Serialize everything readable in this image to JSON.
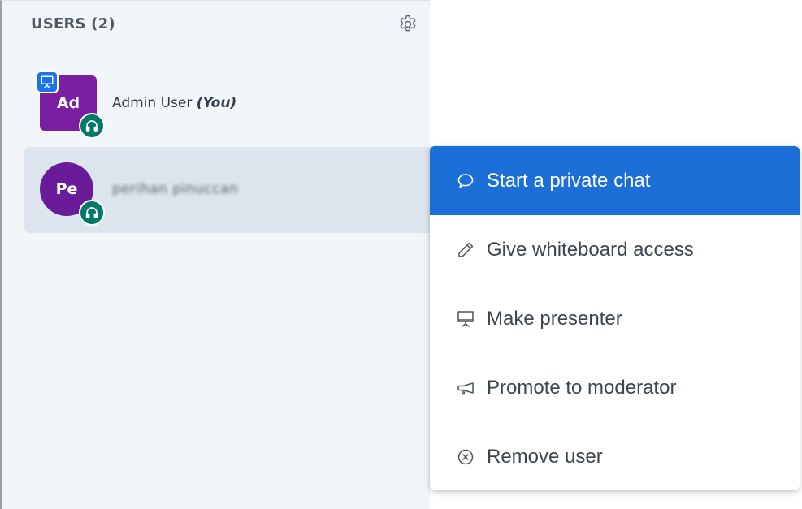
{
  "users_panel": {
    "title": "USERS (2)",
    "settings_icon": "gear-icon",
    "users": [
      {
        "initials": "Ad",
        "name": "Admin User",
        "you_label": "(You)",
        "avatar_color": "#7b1fa2",
        "badges": [
          "presenter-icon",
          "headset-icon"
        ]
      },
      {
        "initials": "Pe",
        "name": "perihan pinuccan",
        "avatar_color": "#6a1b9a",
        "badges": [
          "headset-icon"
        ]
      }
    ]
  },
  "context_menu": {
    "items": [
      {
        "label": "Start a private chat",
        "icon": "chat-bubble-icon",
        "active": true
      },
      {
        "label": "Give whiteboard access",
        "icon": "pencil-icon",
        "active": false
      },
      {
        "label": "Make presenter",
        "icon": "presentation-icon",
        "active": false
      },
      {
        "label": "Promote to moderator",
        "icon": "megaphone-icon",
        "active": false
      },
      {
        "label": "Remove user",
        "icon": "close-circle-icon",
        "active": false
      }
    ]
  },
  "colors": {
    "active_item": "#1b6fd6",
    "panel_bg": "#f3f6f9",
    "selected_row": "#dce4ed",
    "audio_badge": "#00796b",
    "presenter_badge": "#1a73e8"
  }
}
